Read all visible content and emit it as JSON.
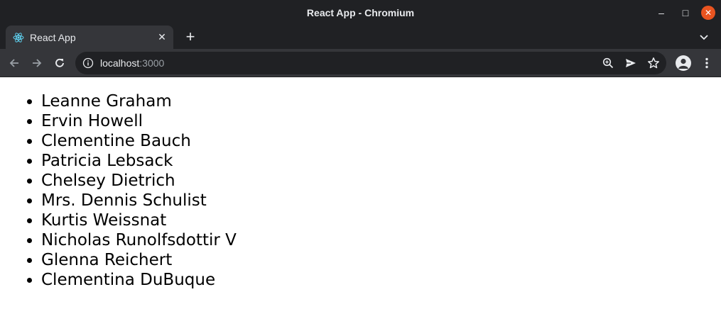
{
  "window": {
    "title": "React App - Chromium",
    "minimize": "–",
    "maximize": "□",
    "close": "✕"
  },
  "tab": {
    "title": "React App",
    "close": "✕",
    "new_tab": "+"
  },
  "address_bar": {
    "host": "localhost",
    "port": ":3000"
  },
  "users": [
    "Leanne Graham",
    "Ervin Howell",
    "Clementine Bauch",
    "Patricia Lebsack",
    "Chelsey Dietrich",
    "Mrs. Dennis Schulist",
    "Kurtis Weissnat",
    "Nicholas Runolfsdottir V",
    "Glenna Reichert",
    "Clementina DuBuque"
  ]
}
